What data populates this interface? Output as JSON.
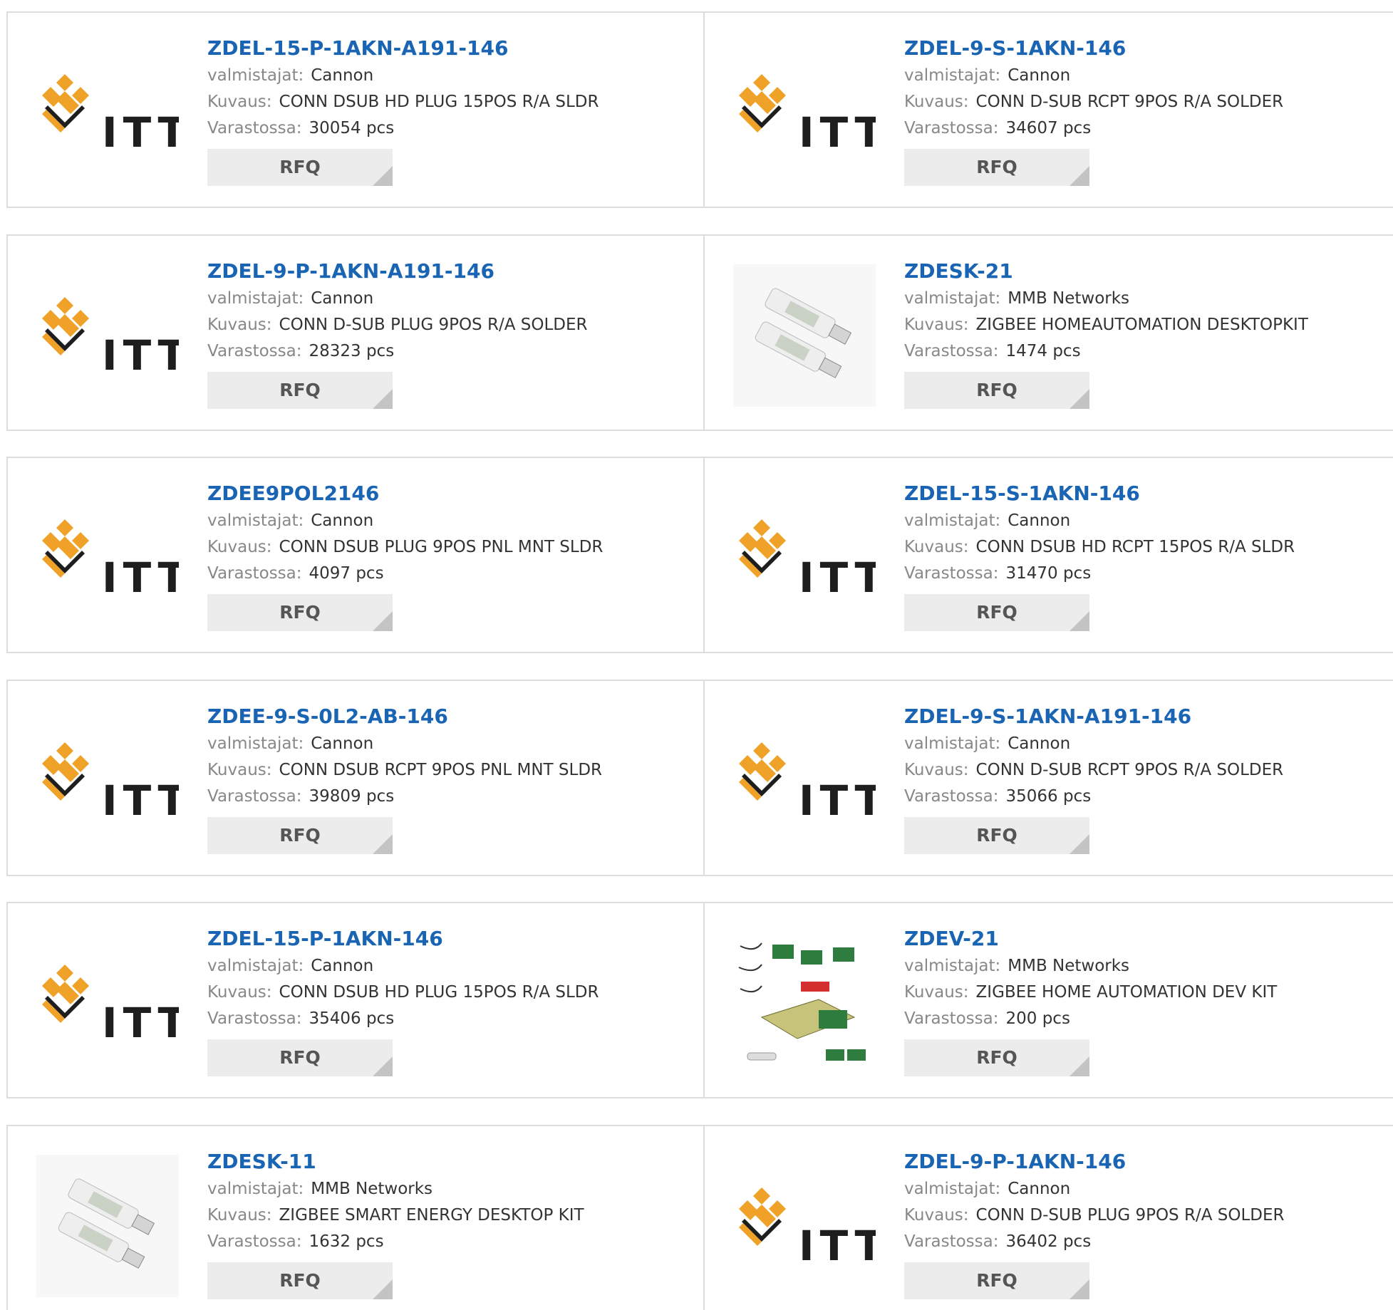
{
  "labels": {
    "manufacturer": "valmistajat:",
    "description": "Kuvaus:",
    "stock": "Varastossa:",
    "rfq": "RFQ"
  },
  "colors": {
    "title_link": "#1a64b4",
    "label_text": "#888888",
    "rfq_button_bg": "#ececec",
    "itt_orange": "#f0a228"
  },
  "products": [
    {
      "part": "ZDEL-15-P-1AKN-A191-146",
      "manufacturer": "Cannon",
      "description": "CONN DSUB HD PLUG 15POS R/A SLDR",
      "stock": "30054 pcs",
      "image": "itt-logo",
      "logo_text": "ITT"
    },
    {
      "part": "ZDEL-9-S-1AKN-146",
      "manufacturer": "Cannon",
      "description": "CONN D-SUB RCPT 9POS R/A SOLDER",
      "stock": "34607 pcs",
      "image": "itt-logo",
      "logo_text": "ITT"
    },
    {
      "part": "ZDEL-9-P-1AKN-A191-146",
      "manufacturer": "Cannon",
      "description": "CONN D-SUB PLUG 9POS R/A SOLDER",
      "stock": "28323 pcs",
      "image": "itt-logo",
      "logo_text": "ITT"
    },
    {
      "part": "ZDESK-21",
      "manufacturer": "MMB Networks",
      "description": "ZIGBEE HOMEAUTOMATION DESKTOPKIT",
      "stock": "1474 pcs",
      "image": "usb-sticks-photo"
    },
    {
      "part": "ZDEE9POL2146",
      "manufacturer": "Cannon",
      "description": "CONN DSUB PLUG 9POS PNL MNT SLDR",
      "stock": "4097 pcs",
      "image": "itt-logo",
      "logo_text": "ITT"
    },
    {
      "part": "ZDEL-15-S-1AKN-146",
      "manufacturer": "Cannon",
      "description": "CONN DSUB HD RCPT 15POS R/A SLDR",
      "stock": "31470 pcs",
      "image": "itt-logo",
      "logo_text": "ITT"
    },
    {
      "part": "ZDEE-9-S-0L2-AB-146",
      "manufacturer": "Cannon",
      "description": "CONN DSUB RCPT 9POS PNL MNT SLDR",
      "stock": "39809 pcs",
      "image": "itt-logo",
      "logo_text": "ITT"
    },
    {
      "part": "ZDEL-9-S-1AKN-A191-146",
      "manufacturer": "Cannon",
      "description": "CONN D-SUB RCPT 9POS R/A SOLDER",
      "stock": "35066 pcs",
      "image": "itt-logo",
      "logo_text": "ITT"
    },
    {
      "part": "ZDEL-15-P-1AKN-146",
      "manufacturer": "Cannon",
      "description": "CONN DSUB HD PLUG 15POS R/A SLDR",
      "stock": "35406 pcs",
      "image": "itt-logo",
      "logo_text": "ITT"
    },
    {
      "part": "ZDEV-21",
      "manufacturer": "MMB Networks",
      "description": "ZIGBEE HOME AUTOMATION DEV KIT",
      "stock": "200 pcs",
      "image": "dev-kit-photo"
    },
    {
      "part": "ZDESK-11",
      "manufacturer": "MMB Networks",
      "description": "ZIGBEE SMART ENERGY DESKTOP KIT",
      "stock": "1632 pcs",
      "image": "usb-sticks-photo"
    },
    {
      "part": "ZDEL-9-P-1AKN-146",
      "manufacturer": "Cannon",
      "description": "CONN D-SUB PLUG 9POS R/A SOLDER",
      "stock": "36402 pcs",
      "image": "itt-logo",
      "logo_text": "ITT"
    }
  ]
}
